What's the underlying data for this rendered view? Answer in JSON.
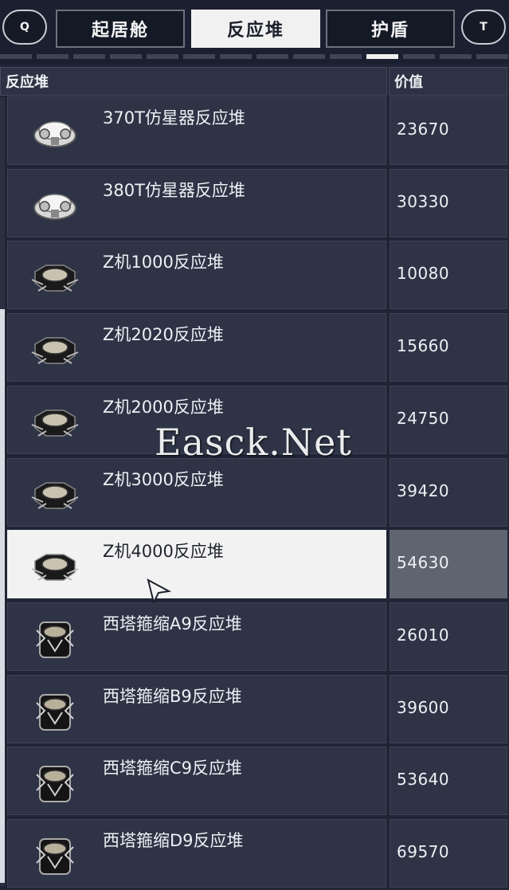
{
  "top_bar": {
    "left_key": "Q",
    "right_key": "T",
    "tabs": [
      {
        "label": "起居舱",
        "active": false
      },
      {
        "label": "反应堆",
        "active": true
      },
      {
        "label": "护盾",
        "active": false
      }
    ],
    "page_indicator": {
      "segments": 14,
      "active_index": 10
    }
  },
  "table": {
    "headers": {
      "name": "反应堆",
      "value": "价值"
    },
    "selected_index": 6,
    "rows": [
      {
        "name": "370T仿星器反应堆",
        "value": "23670",
        "icon": "white-reactor-icon"
      },
      {
        "name": "380T仿星器反应堆",
        "value": "30330",
        "icon": "white-reactor-icon"
      },
      {
        "name": "Z机1000反应堆",
        "value": "10080",
        "icon": "black-reactor-icon"
      },
      {
        "name": "Z机2020反应堆",
        "value": "15660",
        "icon": "black-reactor-icon"
      },
      {
        "name": "Z机2000反应堆",
        "value": "24750",
        "icon": "black-reactor-icon"
      },
      {
        "name": "Z机3000反应堆",
        "value": "39420",
        "icon": "black-reactor-icon"
      },
      {
        "name": "Z机4000反应堆",
        "value": "54630",
        "icon": "black-reactor-icon"
      },
      {
        "name": "西塔箍缩A9反应堆",
        "value": "26010",
        "icon": "cage-reactor-icon"
      },
      {
        "name": "西塔箍缩B9反应堆",
        "value": "39600",
        "icon": "cage-reactor-icon"
      },
      {
        "name": "西塔箍缩C9反应堆",
        "value": "53640",
        "icon": "cage-reactor-icon"
      },
      {
        "name": "西塔箍缩D9反应堆",
        "value": "69570",
        "icon": "cage-reactor-icon"
      }
    ]
  },
  "watermark": "Easck.Net",
  "colors": {
    "panel": "#2e3446",
    "selected": "#f2f2f2",
    "background": "#1f2535"
  }
}
